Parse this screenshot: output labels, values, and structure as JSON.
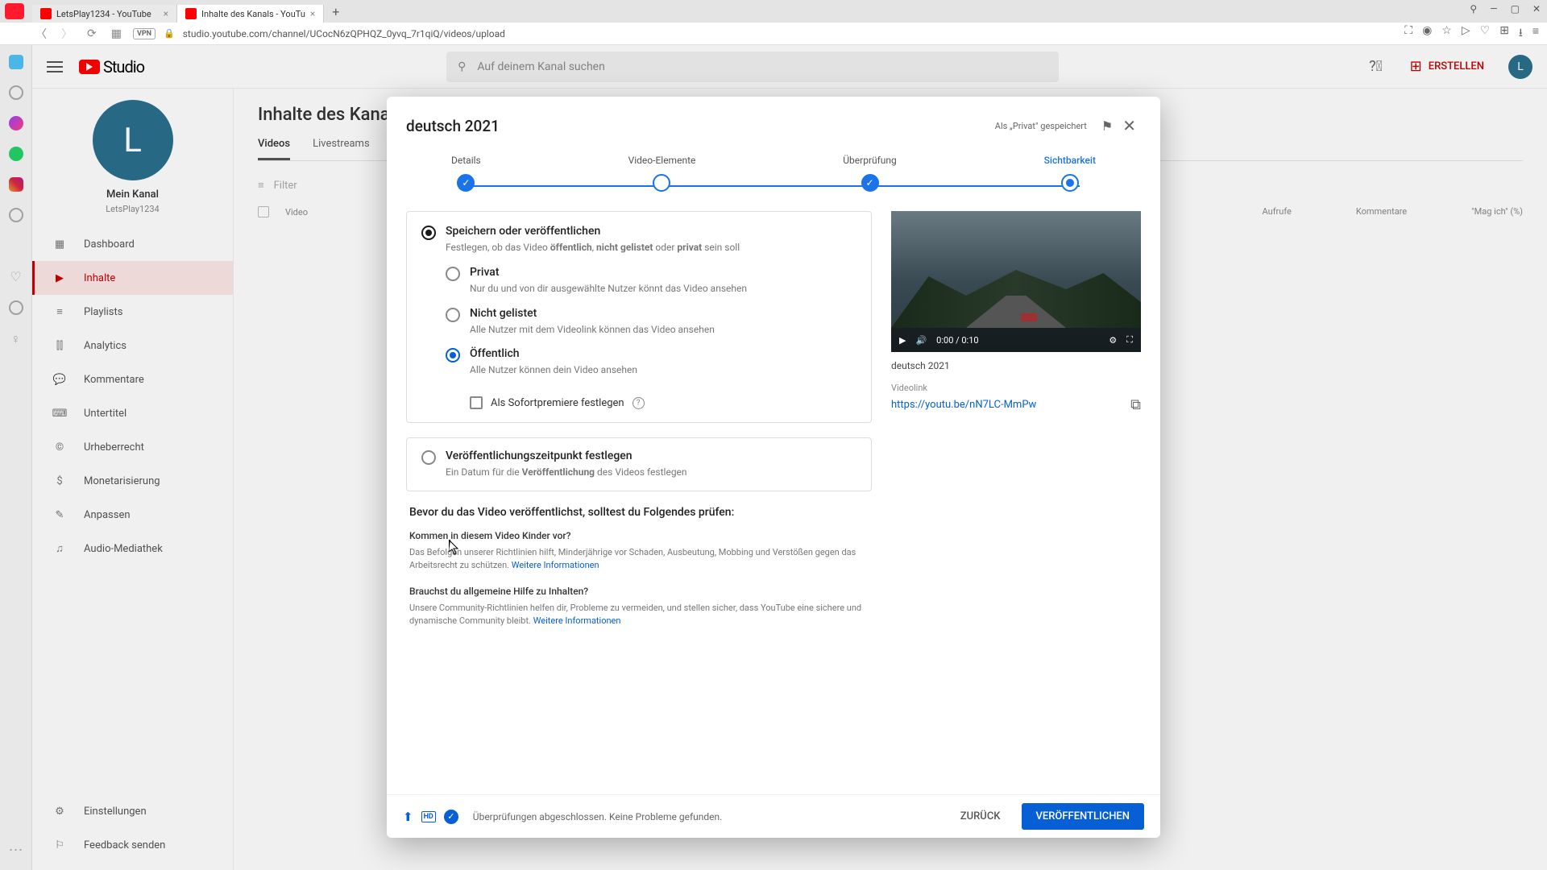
{
  "browser": {
    "tabs": [
      {
        "title": "LetsPlay1234 - YouTube"
      },
      {
        "title": "Inhalte des Kanals - YouTu"
      }
    ],
    "vpn": "VPN",
    "url": "studio.youtube.com/channel/UCocN6zQPHQZ_0yvq_7r1qiQ/videos/upload"
  },
  "studio": {
    "logo": "Studio",
    "search_placeholder": "Auf deinem Kanal suchen",
    "create": "ERSTELLEN",
    "avatar_letter": "L"
  },
  "channel": {
    "avatar_letter": "L",
    "title": "Mein Kanal",
    "name": "LetsPlay1234"
  },
  "nav": {
    "dashboard": "Dashboard",
    "content": "Inhalte",
    "playlists": "Playlists",
    "analytics": "Analytics",
    "comments": "Kommentare",
    "subtitles": "Untertitel",
    "copyright": "Urheberrecht",
    "monetization": "Monetarisierung",
    "customization": "Anpassen",
    "audio": "Audio-Mediathek",
    "settings": "Einstellungen",
    "feedback": "Feedback senden"
  },
  "page": {
    "title": "Inhalte des Kana",
    "tab_videos": "Videos",
    "tab_live": "Livestreams",
    "filter": "Filter",
    "col_video": "Video",
    "col_views": "Aufrufe",
    "col_comments": "Kommentare",
    "col_likes": "\"Mag ich\" (%)"
  },
  "modal": {
    "title": "deutsch 2021",
    "saved": "Als „Privat\" gespeichert",
    "steps": {
      "details": "Details",
      "elements": "Video-Elemente",
      "review": "Überprüfung",
      "visibility": "Sichtbarkeit"
    },
    "save_pub": {
      "title": "Speichern oder veröffentlichen",
      "desc_pre": "Festlegen, ob das Video ",
      "desc_bold1": "öffentlich",
      "desc_mid1": ", ",
      "desc_bold2": "nicht gelistet",
      "desc_mid2": " oder ",
      "desc_bold3": "privat",
      "desc_post": " sein soll"
    },
    "private": {
      "title": "Privat",
      "desc": "Nur du und von dir ausgewählte Nutzer könnt das Video ansehen"
    },
    "unlisted": {
      "title": "Nicht gelistet",
      "desc": "Alle Nutzer mit dem Videolink können das Video ansehen"
    },
    "public": {
      "title": "Öffentlich",
      "desc": "Alle Nutzer können dein Video ansehen"
    },
    "premiere": "Als Sofortpremiere festlegen",
    "schedule": {
      "title": "Veröffentlichungszeitpunkt festlegen",
      "desc_pre": "Ein Datum für die ",
      "desc_bold": "Veröffentlichung",
      "desc_post": " des Videos festlegen"
    },
    "before": {
      "title": "Bevor du das Video veröffentlichst, solltest du Folgendes prüfen:",
      "kids_q": "Kommen in diesem Video Kinder vor?",
      "kids_txt": "Das Befolgen unserer Richtlinien hilft, Minderjährige vor Schaden, Ausbeutung, Mobbing und Verstößen gegen das Arbeitsrecht zu schützen. ",
      "more_info": "Weitere Informationen",
      "help_q": "Brauchst du allgemeine Hilfe zu Inhalten?",
      "help_txt": "Unsere Community-Richtlinien helfen dir, Probleme zu vermeiden, und stellen sicher, dass YouTube eine sichere und dynamische Community bleibt. "
    },
    "preview": {
      "time": "0:00 / 0:10",
      "title": "deutsch 2021",
      "link_label": "Videolink",
      "link": "https://youtu.be/nN7LC-MmPw"
    },
    "footer": {
      "status": "Überprüfungen abgeschlossen. Keine Probleme gefunden.",
      "back": "ZURÜCK",
      "publish": "VERÖFFENTLICHEN"
    }
  }
}
